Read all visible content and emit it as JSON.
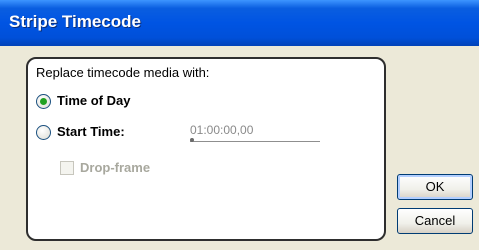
{
  "window": {
    "title": "Stripe Timecode"
  },
  "group": {
    "prompt": "Replace timecode media with:",
    "options": [
      {
        "label": "Time of Day",
        "selected": true
      },
      {
        "label": "Start Time:",
        "selected": false
      }
    ],
    "start_time_value": "01:00:00,00",
    "drop_frame": {
      "label": "Drop-frame",
      "checked": false,
      "enabled": false
    }
  },
  "buttons": {
    "ok": "OK",
    "cancel": "Cancel"
  },
  "colors": {
    "titlebar": "#0054e3",
    "dialog_bg": "#ece9d8",
    "radio_dot": "#21a121",
    "disabled_text": "#a8a89e"
  }
}
